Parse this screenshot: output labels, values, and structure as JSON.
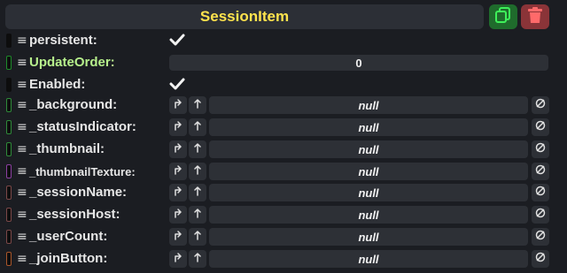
{
  "header": {
    "title": "SessionItem"
  },
  "fields": [
    {
      "label": "persistent:",
      "kind": "bool",
      "checked": true,
      "handle_color": "#0d0d0d",
      "label_style": "normal"
    },
    {
      "label": "UpdateOrder:",
      "kind": "number",
      "value": "0",
      "handle_color": "#1e8a2a",
      "label_style": "green"
    },
    {
      "label": "Enabled:",
      "kind": "bool",
      "checked": true,
      "handle_color": "#0d0d0d",
      "label_style": "normal"
    },
    {
      "label": "_background:",
      "kind": "ref",
      "value": "null",
      "handle_color": "#2f8a3a",
      "label_style": "normal"
    },
    {
      "label": "_statusIndicator:",
      "kind": "ref",
      "value": "null",
      "handle_color": "#2f8a3a",
      "label_style": "normal"
    },
    {
      "label": "_thumbnail:",
      "kind": "ref",
      "value": "null",
      "handle_color": "#2f8a3a",
      "label_style": "normal"
    },
    {
      "label": "_thumbnailTexture:",
      "kind": "ref",
      "value": "null",
      "handle_color": "#8a3fa0",
      "label_style": "small"
    },
    {
      "label": "_sessionName:",
      "kind": "ref",
      "value": "null",
      "handle_color": "#7a4848",
      "label_style": "normal"
    },
    {
      "label": "_sessionHost:",
      "kind": "ref",
      "value": "null",
      "handle_color": "#7a4848",
      "label_style": "normal"
    },
    {
      "label": "_userCount:",
      "kind": "ref",
      "value": "null",
      "handle_color": "#7a4848",
      "label_style": "normal"
    },
    {
      "label": "_joinButton:",
      "kind": "ref",
      "value": "null",
      "handle_color": "#a8552a",
      "label_style": "normal"
    }
  ],
  "icons": {
    "duplicate": "duplicate-icon",
    "delete": "trash-icon",
    "menu": "hamburger-icon",
    "check": "check-icon",
    "jump": "jump-to-icon",
    "up": "parent-up-icon",
    "clear": "null-clear-icon"
  },
  "colors": {
    "title": "#ffe34d",
    "duplicate_bg": "#1f6b2c",
    "delete_bg": "#8a3438",
    "field_bg": "#2d3036",
    "panel_bg": "#1b1d22"
  }
}
